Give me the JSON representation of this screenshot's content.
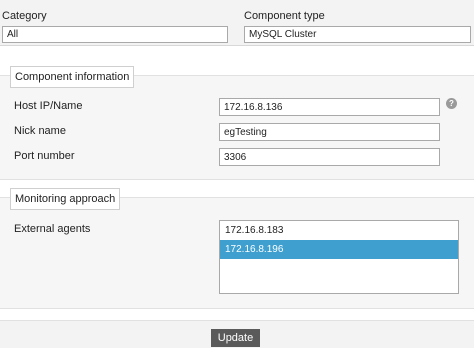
{
  "header": {
    "category_label": "Category",
    "category_value": "All",
    "component_type_label": "Component type",
    "component_type_value": "MySQL Cluster"
  },
  "component_info": {
    "legend": "Component information",
    "host_label": "Host IP/Name",
    "host_value": "172.16.8.136",
    "help_icon": "question-circle",
    "nick_label": "Nick name",
    "nick_value": "egTesting",
    "port_label": "Port number",
    "port_value": "3306"
  },
  "monitoring": {
    "legend": "Monitoring approach",
    "agents_label": "External agents",
    "agents": [
      "172.16.8.183",
      "172.16.8.196"
    ],
    "selected_agent": "172.16.8.196"
  },
  "footer": {
    "update_label": "Update"
  },
  "colors": {
    "selected_bg": "#3fa0d0",
    "button_bg": "#5a5a5a"
  }
}
